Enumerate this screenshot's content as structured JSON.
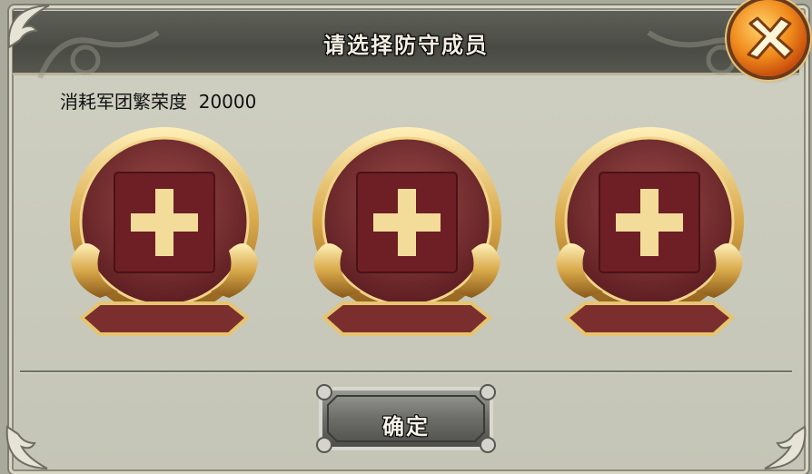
{
  "dialog": {
    "title": "请选择防守成员",
    "cost_label": "消耗军团繁荣度  20000",
    "confirm_label": "确定"
  },
  "slots": [
    {
      "icon": "plus-icon",
      "name": ""
    },
    {
      "icon": "plus-icon",
      "name": ""
    },
    {
      "icon": "plus-icon",
      "name": ""
    }
  ],
  "colors": {
    "panel_bg": "#c8c9bb",
    "title_bar": "#4f504a",
    "gold": "#d9b25a",
    "slot_inner": "#7a2b2e",
    "close_orange": "#f08a1c"
  }
}
